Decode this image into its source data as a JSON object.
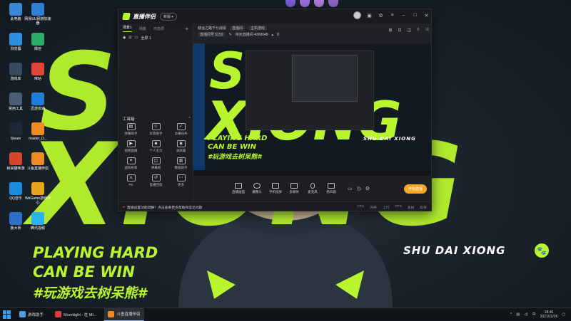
{
  "desktop": {
    "bg_text_top": "SHUI",
    "bg_text_mid": "XIONG",
    "slogan_line1": "PLAYING HARD",
    "slogan_line2": "CAN BE WIN",
    "slogan_line3": "#玩游戏去树呆熊#",
    "brand_text": "SHU DAI XIONG",
    "accent_color": "#b8f52e",
    "icons": [
      {
        "label": "此电脑",
        "icon": "computer-icon",
        "color": "#3a86d4"
      },
      {
        "label": "网易UU网游加速器",
        "icon": "uu-icon",
        "color": "#2f7fd6"
      },
      {
        "label": "浏览器",
        "icon": "browser-icon",
        "color": "#2d8fe0"
      },
      {
        "label": "微信",
        "icon": "wechat-icon",
        "color": "#2aae67"
      },
      {
        "label": "游戏库",
        "icon": "game-library-icon",
        "color": "#3a4a5e"
      },
      {
        "label": "咪咕",
        "icon": "migu-icon",
        "color": "#e0453a"
      },
      {
        "label": "常用工具",
        "icon": "tools-icon",
        "color": "#4b5e75"
      },
      {
        "label": "迅游加速",
        "icon": "xunyou-icon",
        "color": "#1f7fd8"
      },
      {
        "label": "Steam",
        "icon": "steam-icon",
        "color": "#1b2838"
      },
      {
        "label": "master_D...",
        "icon": "master-icon",
        "color": "#f08a24"
      },
      {
        "label": "树呆猫咪游",
        "icon": "game-icon",
        "color": "#d8442a"
      },
      {
        "label": "斗鱼直播伴侣",
        "icon": "douyu-icon",
        "color": "#f08a24"
      },
      {
        "label": "QQ音乐",
        "icon": "qq-icon",
        "color": "#1a8be0"
      },
      {
        "label": "WeGame游戏中心",
        "icon": "wegame-icon",
        "color": "#e7a41e"
      },
      {
        "label": "鲁大师",
        "icon": "ludashi-icon",
        "color": "#2a6fc9"
      },
      {
        "label": "腾讯视频",
        "icon": "tencent-video-icon",
        "color": "#2bb2f0"
      }
    ]
  },
  "app": {
    "title": "直播伴侣",
    "version": "新版 ▾",
    "scene_tabs": [
      "场景1",
      "场景",
      "可选项"
    ],
    "scene_label": "全屏 1",
    "tools_title": "工具箱",
    "tools": [
      "弹幕助手",
      "房管助手",
      "主播任务",
      "视频直播",
      "个人主页",
      "录屏器",
      "虚拟形象",
      "弹幕姬",
      "数据助手",
      "PK",
      "直播回放",
      "更多"
    ],
    "stream_title": "蚌运之路千分战役",
    "stream_room": "直播间",
    "stream_category": "主机游戏",
    "stream_meta1": "直播间号 5159",
    "stream_meta2": "待定直播间 4368048",
    "stream_meta3": "8",
    "bottom_tools": [
      "直播画面",
      "摄像头",
      "手机投屏",
      "多媒体",
      "麦克风",
      "扬声器"
    ],
    "go_live": "开始直播",
    "notice": "直播设置功能调整？点击查看更多帮助和常见问题",
    "status_items": [
      "CPU",
      "内存",
      "上行",
      "FPS",
      "丢帧",
      "码率"
    ]
  },
  "taskbar": {
    "items": [
      {
        "label": "游戏助手",
        "icon": "weather-icon",
        "color": "#4aa0e6"
      },
      {
        "label": "Moonlight - 在 MI...",
        "icon": "moonlight-icon",
        "color": "#e03a3a"
      },
      {
        "label": "斗鱼直播伴侣",
        "icon": "douyu-icon",
        "color": "#f08a24"
      }
    ],
    "time": "18:46",
    "date": "2021/11/26",
    "ime": "中"
  }
}
